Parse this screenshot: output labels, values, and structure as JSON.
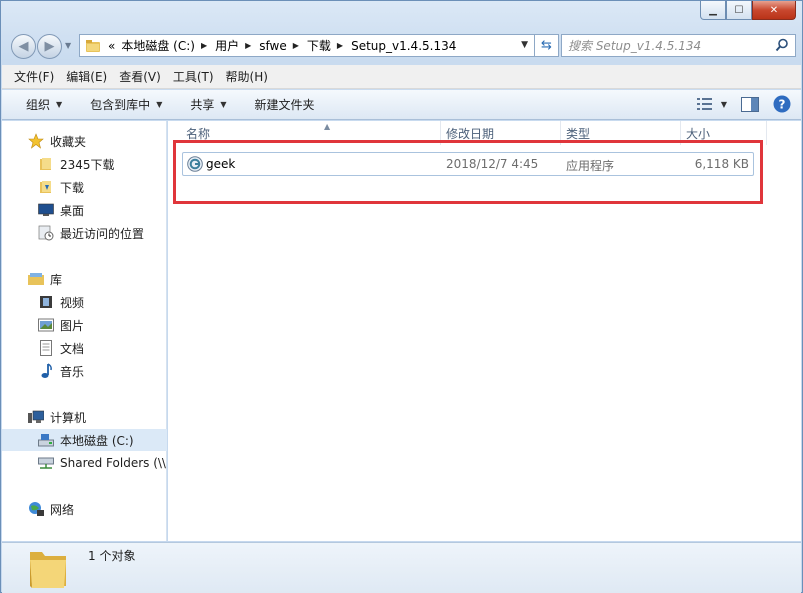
{
  "window": {
    "caption_buttons": {
      "minimize": "▁",
      "maximize": "☐",
      "close": "✕"
    }
  },
  "address_bar": {
    "overflow": "«",
    "crumbs": [
      "本地磁盘 (C:)",
      "用户",
      "sfwe",
      "下载",
      "Setup_v1.4.5.134"
    ]
  },
  "search": {
    "placeholder": "搜索 Setup_v1.4.5.134"
  },
  "menu": [
    "文件(F)",
    "编辑(E)",
    "查看(V)",
    "工具(T)",
    "帮助(H)"
  ],
  "commands": {
    "organize": "组织",
    "include_in_library": "包含到库中",
    "share": "共享",
    "new_folder": "新建文件夹"
  },
  "sidebar": {
    "favorites": {
      "label": "收藏夹",
      "items": [
        "2345下载",
        "下载",
        "桌面",
        "最近访问的位置"
      ]
    },
    "libraries": {
      "label": "库",
      "items": [
        "视频",
        "图片",
        "文档",
        "音乐"
      ]
    },
    "computer": {
      "label": "计算机",
      "items": [
        "本地磁盘 (C:)",
        "Shared Folders (\\\\"
      ]
    },
    "network": {
      "label": "网络"
    }
  },
  "columns": {
    "name": "名称",
    "date": "修改日期",
    "type": "类型",
    "size": "大小"
  },
  "files": [
    {
      "name": "geek",
      "date": "2018/12/7 4:45",
      "type": "应用程序",
      "size": "6,118 KB"
    }
  ],
  "details": {
    "count": "1 个对象"
  },
  "colors": {
    "highlight": "#e0353b",
    "selection": "#dbe9f7",
    "accent": "#2a6cb4"
  },
  "icons": [
    "back-icon",
    "forward-icon",
    "folder-icon",
    "refresh-icon",
    "search-icon",
    "star-icon",
    "desktop-icon",
    "recent-icon",
    "library-icon",
    "video-icon",
    "picture-icon",
    "document-icon",
    "music-icon",
    "computer-icon",
    "drive-icon",
    "network-drive-icon",
    "network-icon",
    "geek-app-icon",
    "view-options-icon",
    "preview-pane-icon",
    "help-icon"
  ]
}
